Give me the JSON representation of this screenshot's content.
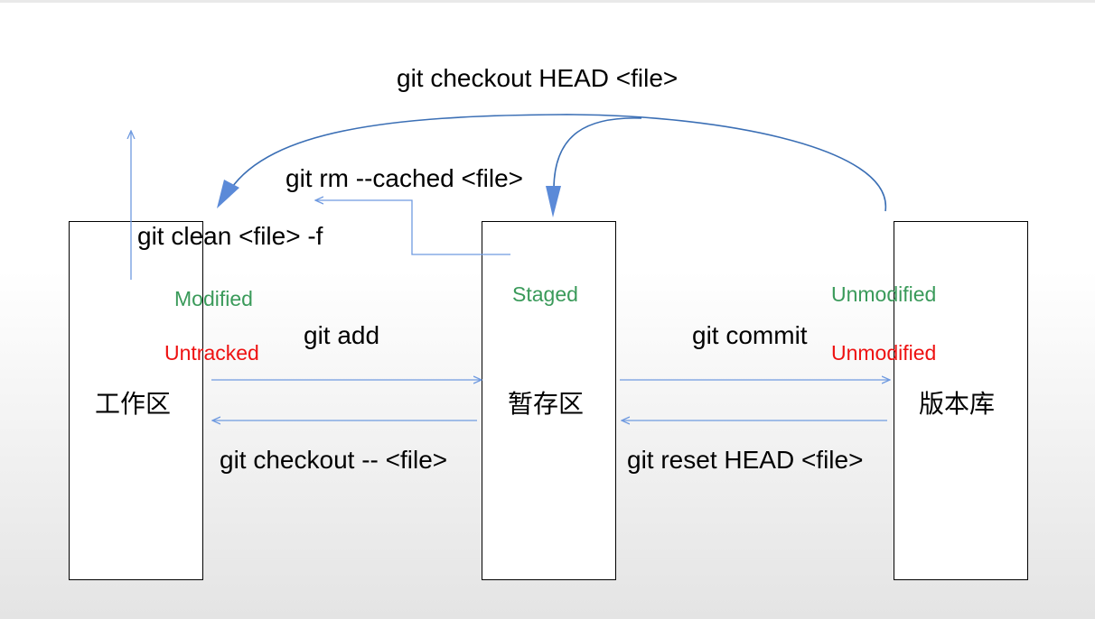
{
  "areas": {
    "working": "工作区",
    "staging": "暂存区",
    "repository": "版本库"
  },
  "commands": {
    "checkout_head": "git checkout HEAD <file>",
    "rm_cached": "git rm --cached <file>",
    "clean": "git clean <file> -f",
    "add": "git add",
    "commit": "git commit",
    "checkout_dash": "git checkout -- <file>",
    "reset_head": "git reset HEAD <file>"
  },
  "states": {
    "modified": "Modified",
    "untracked": "Untracked",
    "staged": "Staged",
    "unmodified_top": "Unmodified",
    "unmodified_bottom": "Unmodified"
  },
  "colors": {
    "state_green": "#3a9a5a",
    "state_red": "#ee1111",
    "arrow_thin": "#6f9ae0",
    "arrow_curve": "#3b6fb5"
  }
}
